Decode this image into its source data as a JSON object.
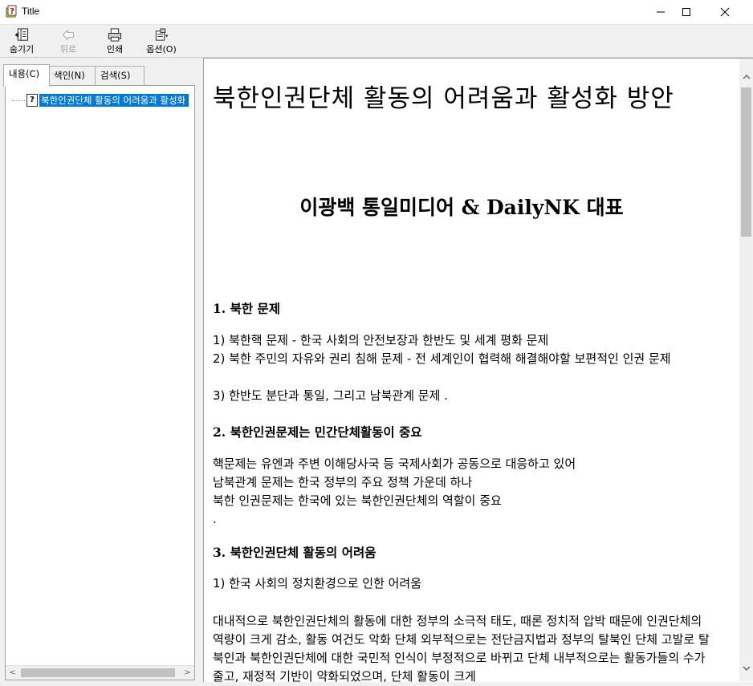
{
  "window": {
    "title": "Title"
  },
  "toolbar": {
    "hide_label": "숨기기",
    "back_label": "뒤로",
    "print_label": "인쇄",
    "options_label": "옵션(O)"
  },
  "tabs": {
    "contents": "내용(C)",
    "index": "색인(N)",
    "search": "검색(S)"
  },
  "tree": {
    "selected_item": "북한인권단체 활동의 어려움과 활성화 방안"
  },
  "document": {
    "title": "북한인권단체 활동의 어려움과 활성화 방안",
    "subtitle": "이광백 통일미디어 & DailyNK 대표",
    "section1_heading": "1. 북한 문제",
    "section1_lines": [
      "1) 북한핵 문제 - 한국 사회의 안전보장과 한반도 및 세계 평화 문제",
      "2) 북한 주민의 자유와 권리 침해 문제 - 전 세계인이 협력해 해결해야할 보편적인 인권 문제",
      "3) 한반도 분단과 통일, 그리고 남북관계 문제 ."
    ],
    "section2_heading": "2. 북한인권문제는 민간단체활동이 중요",
    "section2_lines": [
      "핵문제는 유엔과 주변 이해당사국 등 국제사회가 공동으로 대응하고 있어",
      "남북관계 문제는 한국 정부의 주요 정책 가운데 하나",
      "북한 인권문제는 한국에 있는 북한인권단체의 역할이 중요",
      "."
    ],
    "section3_heading": "3. 북한인권단체 활동의 어려움",
    "section3_item1": "1) 한국 사회의 정치환경으로 인한 어려움",
    "section3_para": "대내적으로 북한인권단체의 활동에 대한 정부의 소극적 태도, 때론 정치적 압박 때문에 인권단체의 역량이 크게 감소, 활동 여건도 악화 단체 외부적으로는 전단금지법과 정부의 탈북인 단체 고발로 탈북인과 북한인권단체에 대한 국민적 인식이 부정적으로 바뀌고 단체 내부적으로는 활동가들의 수가 줄고, 재정적 기반이 약화되었으며, 단체 활동이 크게"
  }
}
